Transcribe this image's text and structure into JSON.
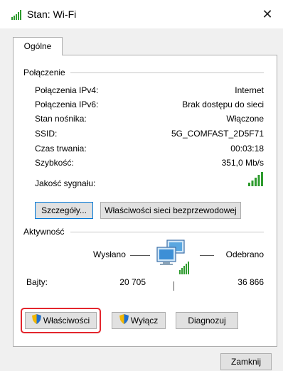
{
  "window": {
    "title": "Stan: Wi-Fi",
    "close_glyph": "✕"
  },
  "tabs": [
    {
      "label": "Ogólne"
    }
  ],
  "connection": {
    "group_label": "Połączenie",
    "rows": [
      {
        "label": "Połączenia IPv4:",
        "value": "Internet"
      },
      {
        "label": "Połączenia IPv6:",
        "value": "Brak dostępu do sieci"
      },
      {
        "label": "Stan nośnika:",
        "value": "Włączone"
      },
      {
        "label": "SSID:",
        "value": "5G_COMFAST_2D5F71"
      },
      {
        "label": "Czas trwania:",
        "value": "00:03:18"
      },
      {
        "label": "Szybkość:",
        "value": "351,0 Mb/s"
      }
    ],
    "signal_label": "Jakość sygnału:",
    "signal_bars": 5
  },
  "buttons_connection": {
    "details": "Szczegóły...",
    "wireless_props": "Właściwości sieci bezprzewodowej"
  },
  "activity": {
    "group_label": "Aktywność",
    "sent_label": "Wysłano",
    "received_label": "Odebrano",
    "bytes_label": "Bajty:",
    "bytes_sent": "20 705",
    "bytes_received": "36 866"
  },
  "buttons_activity": {
    "properties": "Właściwości",
    "disable": "Wyłącz",
    "diagnose": "Diagnozuj"
  },
  "footer": {
    "close": "Zamknij"
  },
  "colors": {
    "accent": "#0078d7",
    "highlight": "#e3262d",
    "signal": "#2e9b2e"
  }
}
